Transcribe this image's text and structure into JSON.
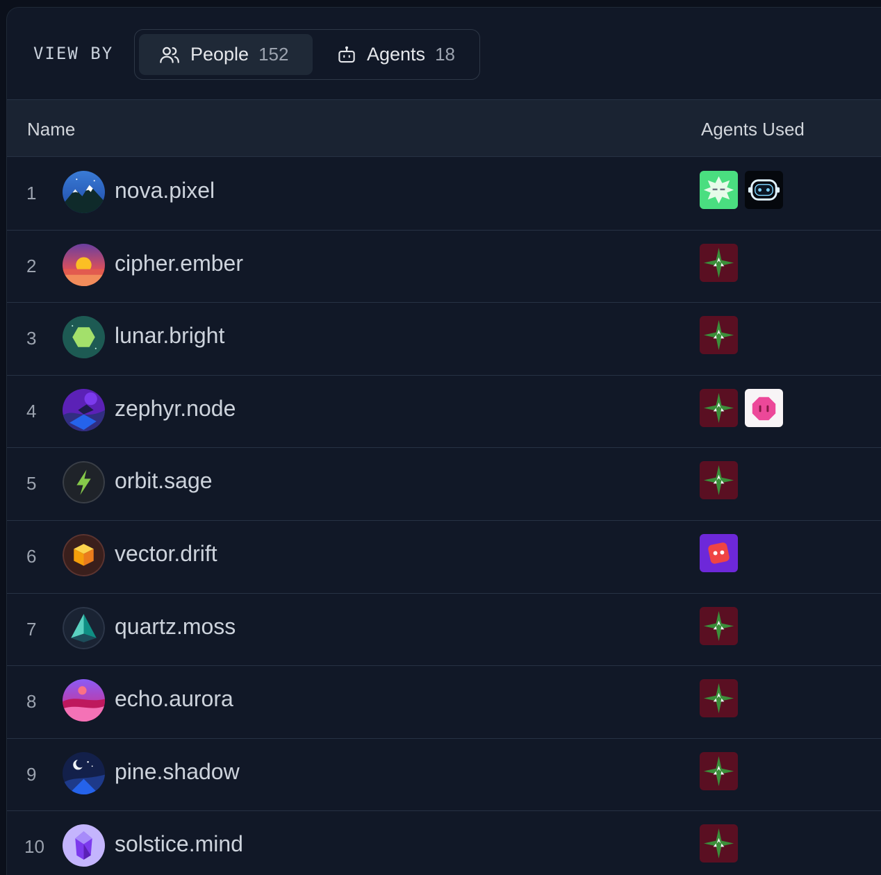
{
  "header": {
    "view_by_label": "VIEW BY",
    "segments": [
      {
        "label": "People",
        "count": "152",
        "icon": "people-icon",
        "active": true
      },
      {
        "label": "Agents",
        "count": "18",
        "icon": "robot-icon",
        "active": false
      }
    ]
  },
  "table": {
    "columns": [
      "Name",
      "Agents Used"
    ],
    "rows": [
      {
        "index": "1",
        "name": "nova.pixel",
        "avatar": "mountain-night-avatar",
        "agents": [
          "green-burst-agent",
          "robot-face-agent"
        ]
      },
      {
        "index": "2",
        "name": "cipher.ember",
        "avatar": "sunset-avatar",
        "agents": [
          "green-star-agent"
        ]
      },
      {
        "index": "3",
        "name": "lunar.bright",
        "avatar": "hexagon-avatar",
        "agents": [
          "green-star-agent"
        ]
      },
      {
        "index": "4",
        "name": "zephyr.node",
        "avatar": "purple-wave-avatar",
        "agents": [
          "green-star-agent",
          "pink-octagon-agent"
        ]
      },
      {
        "index": "5",
        "name": "orbit.sage",
        "avatar": "lightning-avatar",
        "agents": [
          "green-star-agent"
        ]
      },
      {
        "index": "6",
        "name": "vector.drift",
        "avatar": "cube-avatar",
        "agents": [
          "red-dice-agent"
        ]
      },
      {
        "index": "7",
        "name": "quartz.moss",
        "avatar": "pyramid-avatar",
        "agents": [
          "green-star-agent"
        ]
      },
      {
        "index": "8",
        "name": "echo.aurora",
        "avatar": "pink-dunes-avatar",
        "agents": [
          "green-star-agent"
        ]
      },
      {
        "index": "9",
        "name": "pine.shadow",
        "avatar": "moon-avatar",
        "agents": [
          "green-star-agent"
        ]
      },
      {
        "index": "10",
        "name": "solstice.mind",
        "avatar": "crystal-avatar",
        "agents": [
          "green-star-agent"
        ]
      }
    ]
  },
  "colors": {
    "background": "#0b101b",
    "panel": "#111827",
    "header_row": "#1a2332",
    "divider": "#273244",
    "agent_maroon": "#5a0f22",
    "agent_green": "#3b8f3a"
  }
}
